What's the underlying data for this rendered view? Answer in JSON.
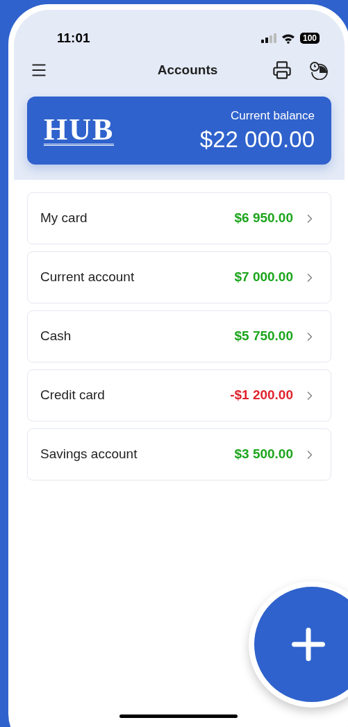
{
  "status_bar": {
    "time": "11:01",
    "battery": "100"
  },
  "header": {
    "title": "Accounts"
  },
  "balance_card": {
    "logo": "HUB",
    "label": "Current balance",
    "amount": "$22 000.00"
  },
  "accounts": [
    {
      "name": "My card",
      "amount": "$6 950.00",
      "negative": false
    },
    {
      "name": "Current account",
      "amount": "$7 000.00",
      "negative": false
    },
    {
      "name": "Cash",
      "amount": "$5 750.00",
      "negative": false
    },
    {
      "name": "Credit card",
      "amount": "-$1 200.00",
      "negative": true
    },
    {
      "name": "Savings account",
      "amount": "$3 500.00",
      "negative": false
    }
  ]
}
